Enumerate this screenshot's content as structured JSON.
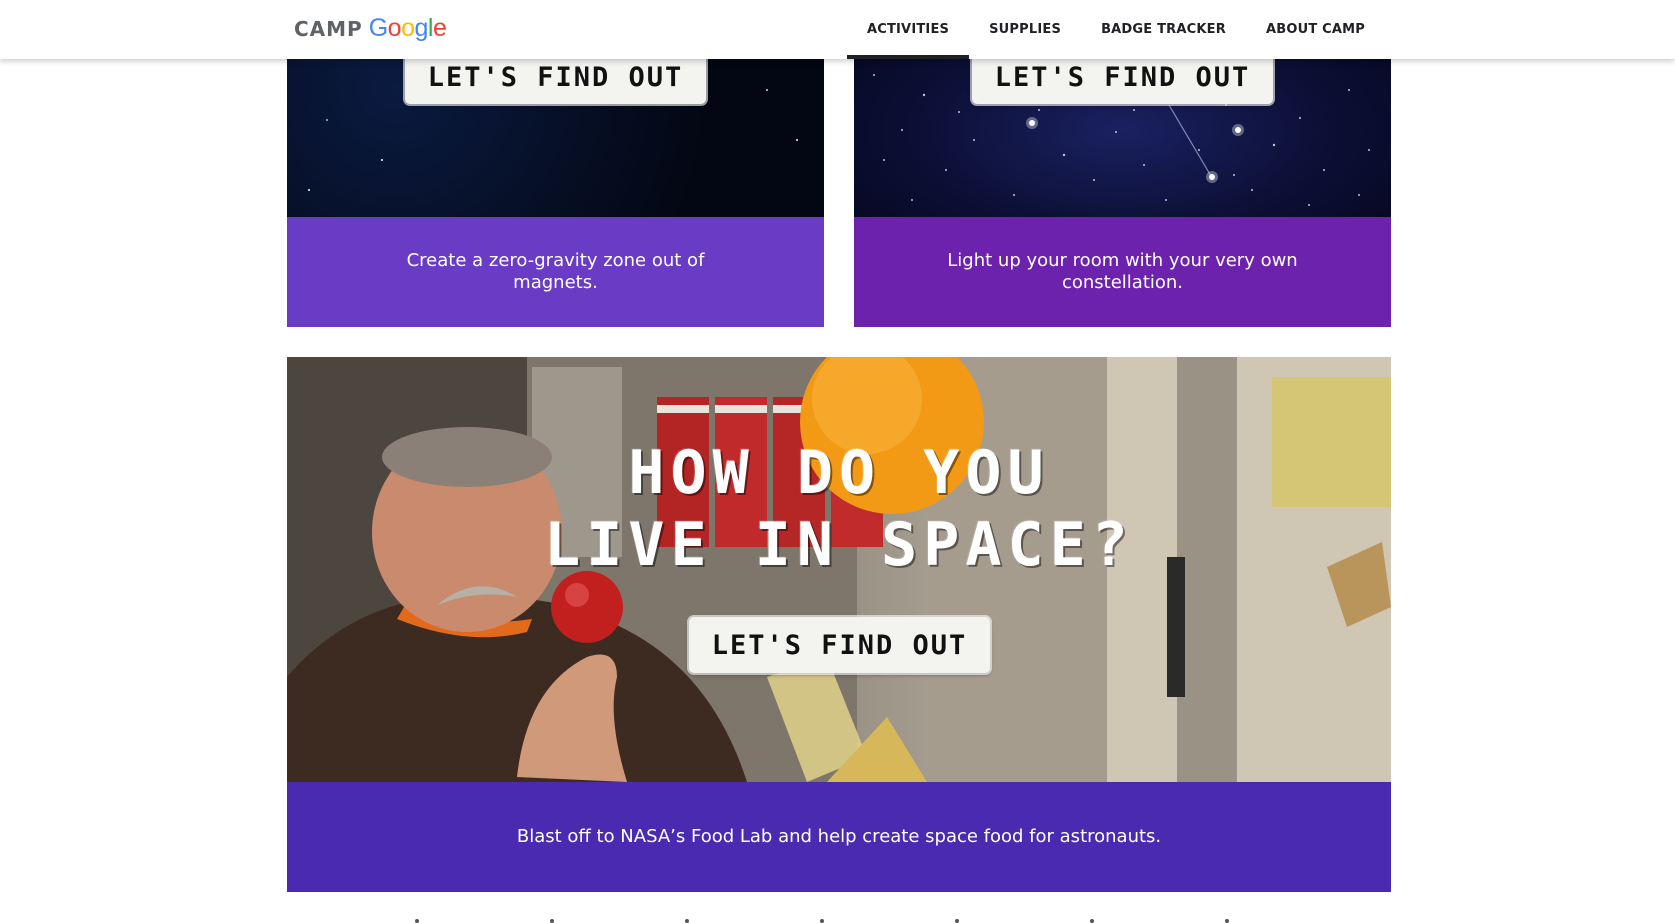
{
  "header": {
    "logo": {
      "camp": "CAMP",
      "google_letters": [
        {
          "char": "G",
          "color": "#4285F4"
        },
        {
          "char": "o",
          "color": "#EA4335"
        },
        {
          "char": "o",
          "color": "#FBBC05"
        },
        {
          "char": "g",
          "color": "#4285F4"
        },
        {
          "char": "l",
          "color": "#34A853"
        },
        {
          "char": "e",
          "color": "#EA4335"
        }
      ]
    },
    "nav": [
      {
        "label": "ACTIVITIES",
        "active": true
      },
      {
        "label": "SUPPLIES",
        "active": false
      },
      {
        "label": "BADGE TRACKER",
        "active": false
      },
      {
        "label": "ABOUT CAMP",
        "active": false
      }
    ]
  },
  "cards": {
    "magnets": {
      "button_label": "LET'S FIND OUT",
      "caption": "Create a zero-gravity zone out of magnets.",
      "caption_bg": "#6a3bc4"
    },
    "constellation": {
      "button_label": "LET'S FIND OUT",
      "caption": "Light up your room with your very own constellation.",
      "caption_bg": "#6c22ac"
    },
    "food": {
      "headline_lines": [
        "HOW DO YOU",
        "LIVE IN SPACE?"
      ],
      "button_label": "LET'S FIND OUT",
      "caption": "Blast off to NASA’s Food Lab and help create space food for astronauts.",
      "caption_bg": "#4a2ab0"
    }
  },
  "colors": {
    "nav_text": "#202124",
    "caption_text": "#ffffff"
  }
}
